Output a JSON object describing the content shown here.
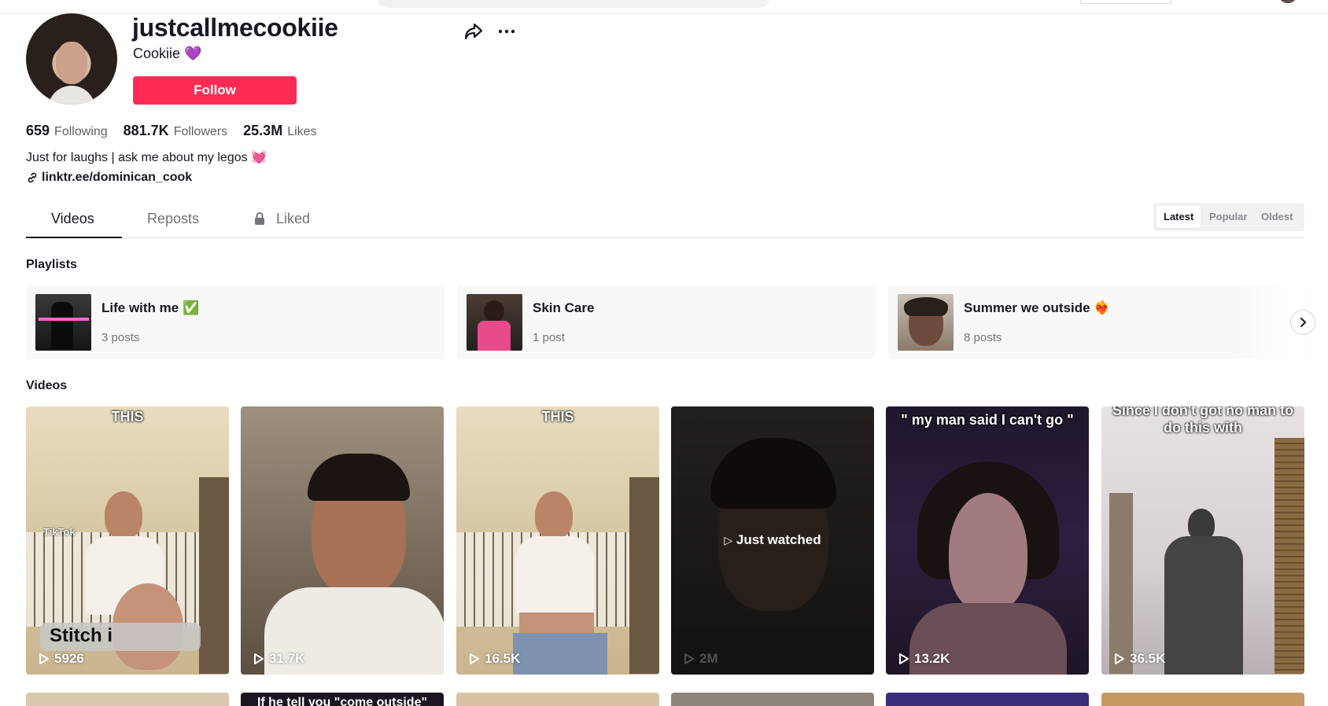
{
  "profile": {
    "username": "justcallmecookiie",
    "nickname": "Cookiie 💜",
    "follow_label": "Follow",
    "stats": {
      "following": {
        "value": "659",
        "label": "Following"
      },
      "followers": {
        "value": "881.7K",
        "label": "Followers"
      },
      "likes": {
        "value": "25.3M",
        "label": "Likes"
      }
    },
    "bio": "Just for laughs | ask me about my legos 💓",
    "link": "linktr.ee/dominican_cook"
  },
  "tabs": [
    {
      "label": "Videos"
    },
    {
      "label": "Reposts"
    },
    {
      "label": "Liked"
    }
  ],
  "sort": [
    "Latest",
    "Popular",
    "Oldest"
  ],
  "sections": {
    "playlists": "Playlists",
    "videos": "Videos"
  },
  "playlists": [
    {
      "title": "Life with me ✅",
      "count": "3 posts"
    },
    {
      "title": "Skin Care",
      "count": "1 post"
    },
    {
      "title": "Summer we outside ❤️‍🔥",
      "count": "8 posts"
    }
  ],
  "videos": [
    {
      "caption": "THIS",
      "views": "5926",
      "overlay_1": "Stitch i",
      "overlay_2": "TikTok"
    },
    {
      "caption": "",
      "views": "31.7K"
    },
    {
      "caption": "THIS",
      "views": "16.5K"
    },
    {
      "caption": "",
      "views": "2M",
      "status": "Just watched"
    },
    {
      "caption": "\" my man said I can't go \"",
      "views": "13.2K"
    },
    {
      "caption": "Since I don't got no man to do this with",
      "views": "36.5K"
    }
  ],
  "videos_row2": [
    {
      "caption": ""
    },
    {
      "caption": "If he tell you \"come outside\""
    },
    {
      "caption": ""
    },
    {
      "caption": ""
    },
    {
      "caption": ""
    },
    {
      "caption": ""
    }
  ],
  "colors": {
    "accent": "#fe2c55",
    "text": "#161823",
    "muted": "#73747b"
  },
  "icons": [
    "share-icon",
    "more-icon",
    "link-icon",
    "lock-icon",
    "play-icon",
    "chevron-right-icon"
  ]
}
